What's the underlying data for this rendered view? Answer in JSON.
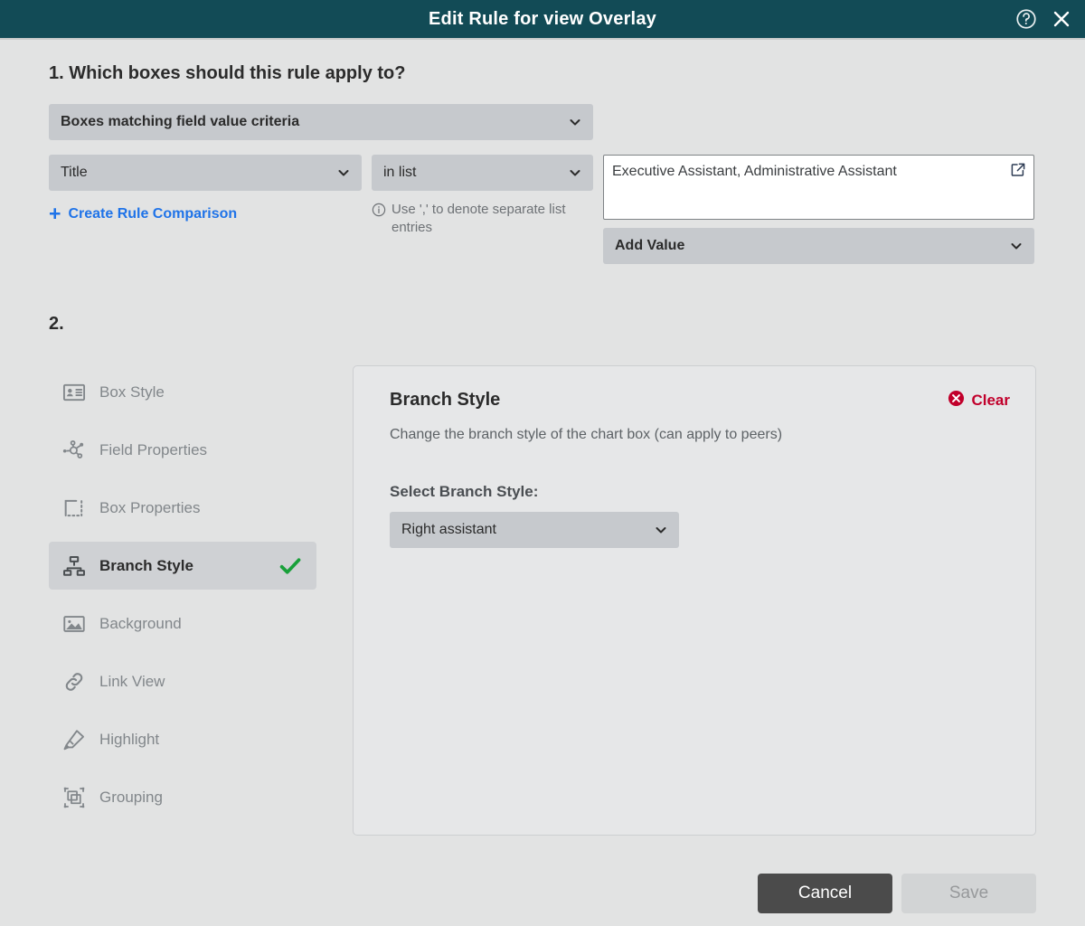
{
  "titlebar": {
    "title": "Edit Rule for view Overlay",
    "help_icon": "help-circle-icon",
    "close_icon": "close-icon",
    "background": "#124b56"
  },
  "step1": {
    "heading": "1. Which boxes should this rule apply to?",
    "scope_select": {
      "value": "Boxes matching field value criteria"
    },
    "field_select": {
      "value": "Title"
    },
    "operator_select": {
      "value": "in list"
    },
    "create_link": {
      "label": "Create Rule Comparison",
      "color": "#1f73e8"
    },
    "hint": "Use ',' to denote separate list entries",
    "value_textarea": {
      "value": "Executive Assistant, Administrative Assistant",
      "placeholder": "",
      "expand_icon": "external-link-icon"
    },
    "add_value_select": {
      "value": "Add Value"
    }
  },
  "step2": {
    "heading": "2.",
    "sidebar": {
      "items": [
        {
          "label": "Box Style",
          "icon": "id-card-icon",
          "active": false
        },
        {
          "label": "Field Properties",
          "icon": "node-graph-icon",
          "active": false
        },
        {
          "label": "Box Properties",
          "icon": "dashed-box-icon",
          "active": false
        },
        {
          "label": "Branch Style",
          "icon": "org-chart-icon",
          "active": true
        },
        {
          "label": "Background",
          "icon": "image-icon",
          "active": false
        },
        {
          "label": "Link View",
          "icon": "link-icon",
          "active": false
        },
        {
          "label": "Highlight",
          "icon": "highlighter-icon",
          "active": false
        },
        {
          "label": "Grouping",
          "icon": "grouping-icon",
          "active": false
        }
      ],
      "check_icon": "check-icon",
      "check_color": "#19a03a"
    },
    "panel": {
      "title": "Branch Style",
      "clear_label": "Clear",
      "clear_icon": "error-circle-x-icon",
      "clear_color": "#c1002b",
      "description": "Change the branch style of the chart box (can apply to peers)",
      "select_label": "Select Branch Style:",
      "branch_select": {
        "value": "Right assistant"
      }
    }
  },
  "footer": {
    "cancel_label": "Cancel",
    "save_label": "Save"
  }
}
